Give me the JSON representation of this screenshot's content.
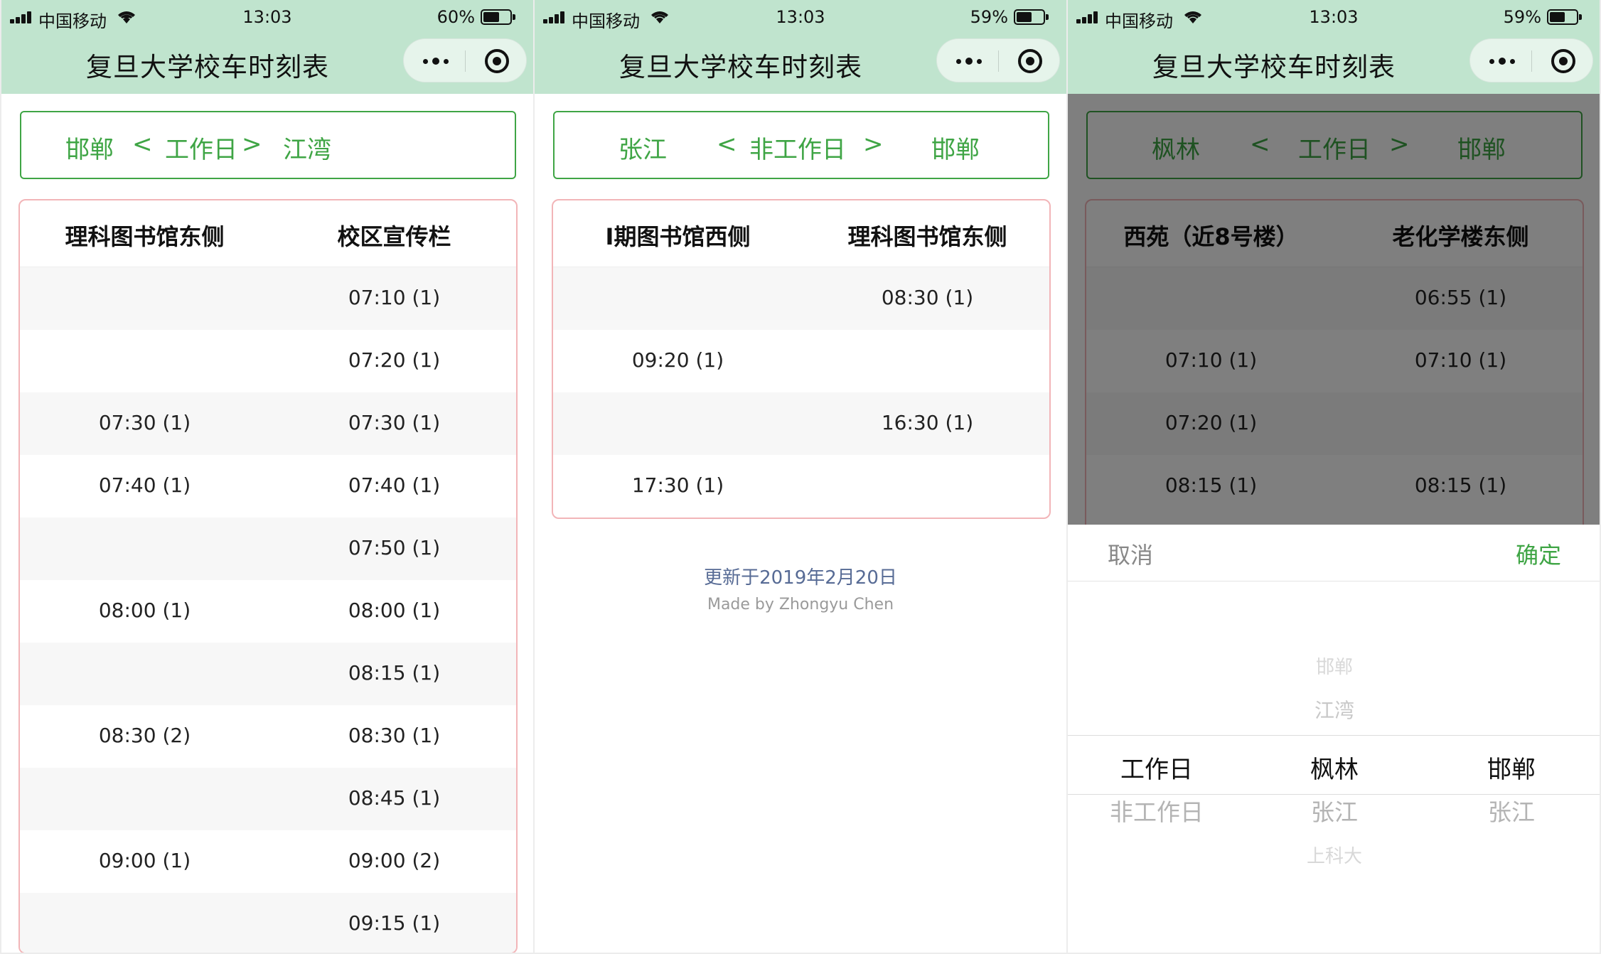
{
  "status_bars": [
    {
      "carrier": "中国移动",
      "time": "13:03",
      "battery": "60%",
      "battery_level": 0.6
    },
    {
      "carrier": "中国移动",
      "time": "13:03",
      "battery": "59%",
      "battery_level": 0.59
    },
    {
      "carrier": "中国移动",
      "time": "13:03",
      "battery": "59%",
      "battery_level": 0.59
    }
  ],
  "app_title": "复旦大学校车时刻表",
  "icons": {
    "more": "more-dots-icon",
    "close": "close-miniprogram-icon",
    "signal": "signal-icon",
    "wifi": "wifi-icon",
    "battery": "battery-icon"
  },
  "colors": {
    "accent": "#3fa545",
    "header_bg": "#c0e4ce",
    "table_border": "#f2b5b8",
    "link": "#576b95"
  },
  "screens": [
    {
      "switch": {
        "from": "邯郸",
        "prev": "<",
        "day_type": "工作日",
        "next": ">",
        "to": "江湾"
      },
      "columns": [
        "理科图书馆东侧",
        "校区宣传栏"
      ],
      "rows": [
        [
          "",
          "07:10 (1)"
        ],
        [
          "",
          "07:20 (1)"
        ],
        [
          "07:30 (1)",
          "07:30 (1)"
        ],
        [
          "07:40 (1)",
          "07:40 (1)"
        ],
        [
          "",
          "07:50 (1)"
        ],
        [
          "08:00 (1)",
          "08:00 (1)"
        ],
        [
          "",
          "08:15 (1)"
        ],
        [
          "08:30 (2)",
          "08:30 (1)"
        ],
        [
          "",
          "08:45 (1)"
        ],
        [
          "09:00 (1)",
          "09:00 (2)"
        ],
        [
          "",
          "09:15 (1)"
        ]
      ]
    },
    {
      "switch": {
        "from": "张江",
        "prev": "<",
        "day_type": "非工作日",
        "next": ">",
        "to": "邯郸"
      },
      "columns": [
        "I期图书馆西侧",
        "理科图书馆东侧"
      ],
      "rows": [
        [
          "",
          "08:30 (1)"
        ],
        [
          "09:20 (1)",
          ""
        ],
        [
          "",
          "16:30 (1)"
        ],
        [
          "17:30 (1)",
          ""
        ]
      ],
      "updated": "更新于2019年2月20日",
      "credit": "Made by Zhongyu Chen"
    },
    {
      "switch": {
        "from": "枫林",
        "prev": "<",
        "day_type": "工作日",
        "next": ">",
        "to": "邯郸"
      },
      "columns": [
        "西苑（近8号楼）",
        "老化学楼东侧"
      ],
      "rows": [
        [
          "",
          "06:55 (1)"
        ],
        [
          "07:10 (1)",
          "07:10 (1)"
        ],
        [
          "07:20 (1)",
          ""
        ],
        [
          "08:15 (1)",
          "08:15 (1)"
        ]
      ]
    }
  ],
  "picker": {
    "cancel": "取消",
    "confirm": "确定",
    "day_column": {
      "selected": "工作日",
      "below": "非工作日"
    },
    "from_column": {
      "above2": "邯郸",
      "above1": "江湾",
      "selected": "枫林",
      "below1": "张江",
      "below2": "上科大"
    },
    "to_column": {
      "selected": "邯郸",
      "below": "张江"
    }
  }
}
